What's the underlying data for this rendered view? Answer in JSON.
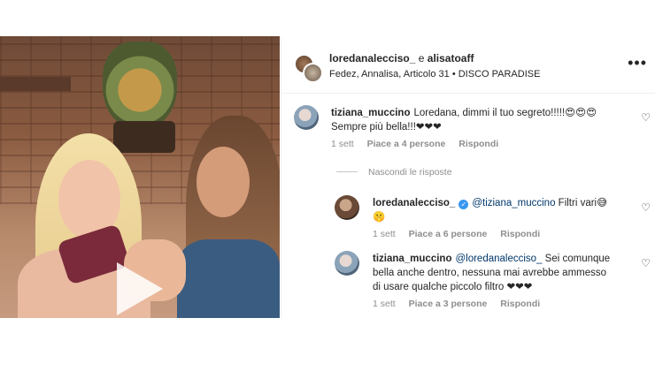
{
  "post": {
    "author": "loredanalecciso_",
    "and_word": "e",
    "coauthor": "alisatoaff",
    "audio": "Fedez, Annalisa, Articolo 31",
    "location": "DISCO PARADISE",
    "more_icon": "more-horizontal-icon"
  },
  "comments": [
    {
      "user": "tiziana_muccino",
      "text_line1": "Loredana, dimmi il tuo segreto!!!!!😍😍😍",
      "text_line2": "Sempre più bella!!!❤❤❤",
      "time": "1 sett",
      "likes": "Piace a 4 persone",
      "reply": "Rispondi"
    }
  ],
  "hide_replies": "Nascondi le risposte",
  "replies": [
    {
      "user": "loredanalecciso_",
      "mention": "@tiziana_muccino",
      "text": "Filtri vari😅",
      "text_line2": "🤫",
      "time": "1 sett",
      "likes": "Piace a 6 persone",
      "reply": "Rispondi"
    },
    {
      "user": "tiziana_muccino",
      "mention": "@loredanalecciso_",
      "text": "Sei comunque",
      "text_line2": "bella anche dentro, nessuna mai avrebbe ammesso",
      "text_line3": "di usare qualche piccolo filtro ❤❤❤",
      "time": "1 sett",
      "likes": "Piace a 3 persone",
      "reply": "Rispondi"
    }
  ]
}
